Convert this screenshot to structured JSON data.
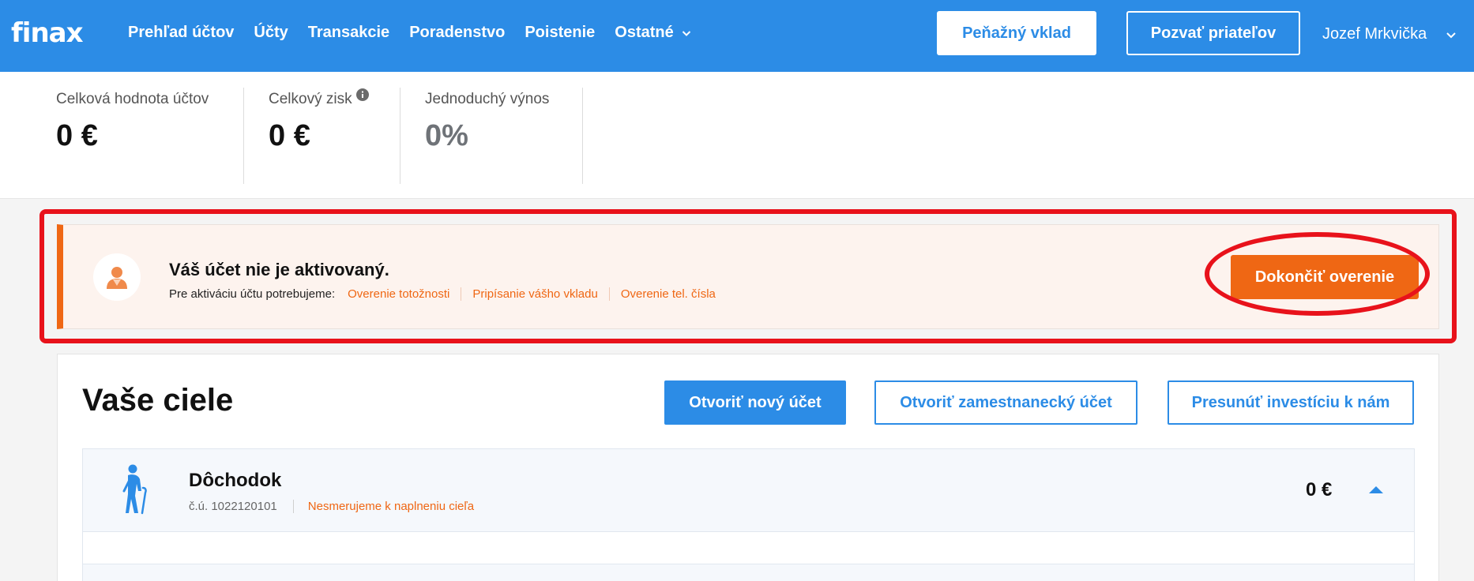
{
  "brand": {
    "logo": "finax",
    "primary_color": "#2c8ce6",
    "accent_color": "#ef6714",
    "highlight_color": "#e8121b"
  },
  "nav": {
    "items": [
      "Prehľad účtov",
      "Účty",
      "Transakcie",
      "Poradenstvo",
      "Poistenie",
      "Ostatné"
    ],
    "deposit_button": "Peňažný vklad",
    "invite_button": "Pozvať priateľov",
    "user_name": "Jozef Mrkvička"
  },
  "stats": [
    {
      "label": "Celková hodnota účtov",
      "value": "0 €"
    },
    {
      "label": "Celkový zisk",
      "value": "0 €"
    },
    {
      "label": "Jednoduchý výnos",
      "value": "0%"
    }
  ],
  "alert": {
    "title": "Váš účet nie je aktivovaný.",
    "prefix": "Pre aktiváciu účtu potrebujeme:",
    "requirements": [
      "Overenie totožnosti",
      "Pripísanie vášho vkladu",
      "Overenie tel. čísla"
    ],
    "action_button": "Dokončiť overenie"
  },
  "goals": {
    "title": "Vaše ciele",
    "open_account_button": "Otvoriť nový účet",
    "open_employee_account_button": "Otvoriť zamestnanecký účet",
    "transfer_investment_button": "Presunúť investíciu k nám",
    "items": [
      {
        "name": "Dôchodok",
        "account": "č.ú. 1022120101",
        "status": "Nesmerujeme k naplneniu cieľa",
        "amount": "0 €",
        "icon": "elderly-person-icon"
      }
    ]
  }
}
